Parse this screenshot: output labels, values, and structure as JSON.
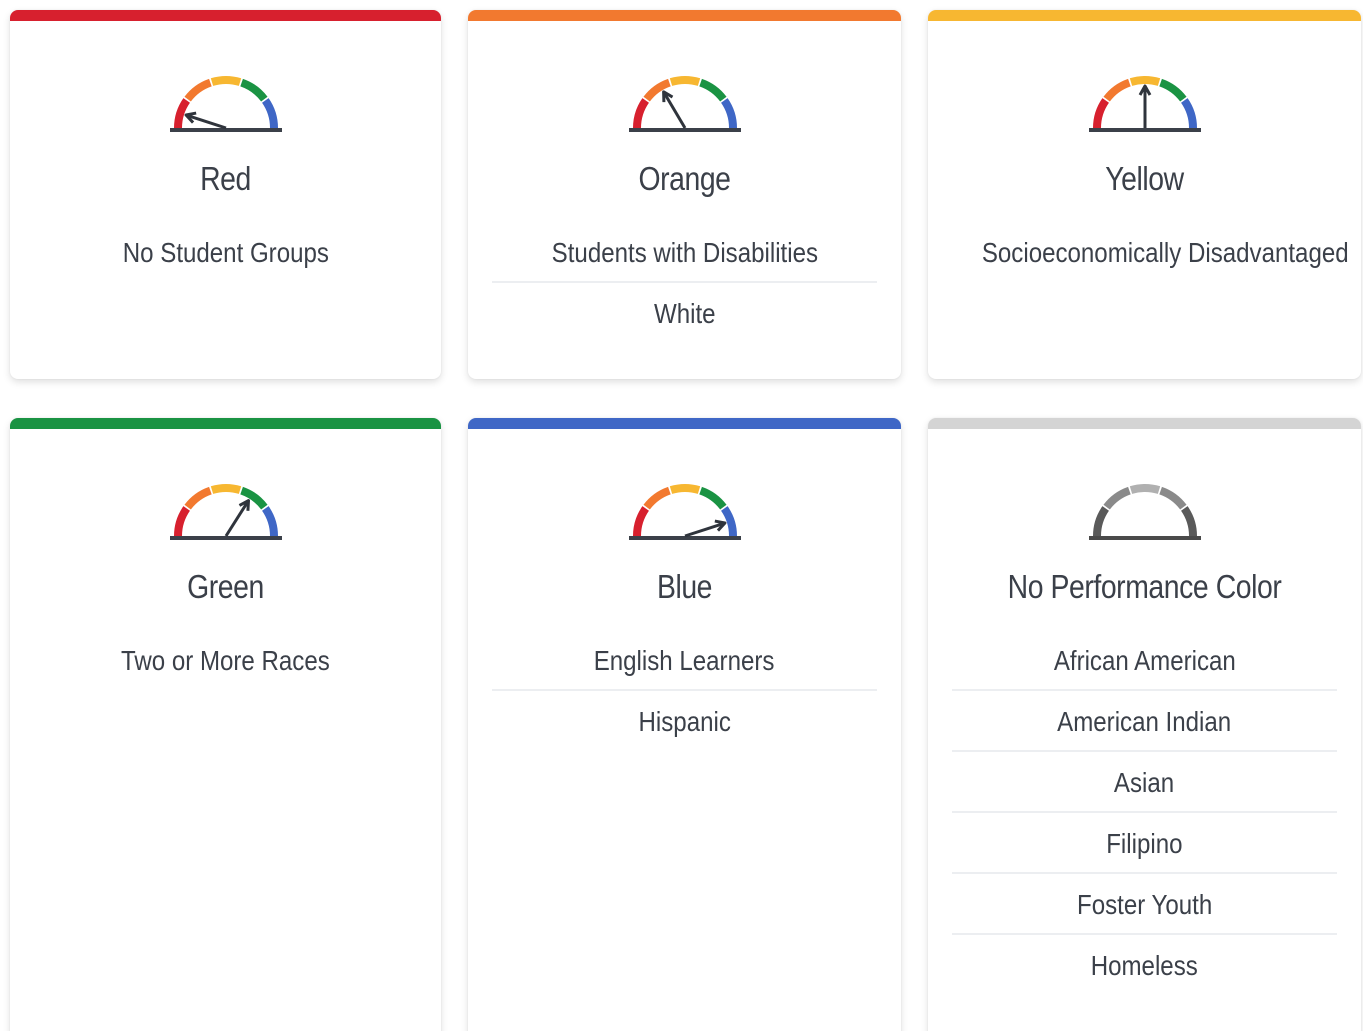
{
  "cards": [
    {
      "title": "Red",
      "accent": "#d7202e",
      "gauge": "active",
      "needle_level": 0.1,
      "groups": [
        "No Student Groups"
      ]
    },
    {
      "title": "Orange",
      "accent": "#f2792f",
      "gauge": "active",
      "needle_level": 0.33,
      "groups": [
        "Students with Disabilities",
        "White"
      ]
    },
    {
      "title": "Yellow",
      "accent": "#f7b731",
      "gauge": "active",
      "needle_level": 0.5,
      "groups": [
        "Socioeconomically Disadvantaged"
      ]
    },
    {
      "title": "Green",
      "accent": "#1a9343",
      "gauge": "active",
      "needle_level": 0.68,
      "groups": [
        "Two or More Races"
      ]
    },
    {
      "title": "Blue",
      "accent": "#3f67c6",
      "gauge": "active",
      "needle_level": 0.9,
      "groups": [
        "English Learners",
        "Hispanic"
      ]
    },
    {
      "title": "No Performance Color",
      "accent": "#d4d4d4",
      "gauge": "inactive",
      "needle_level": null,
      "groups": [
        "African American",
        "American Indian",
        "Asian",
        "Filipino",
        "Foster Youth",
        "Homeless"
      ]
    }
  ],
  "gauge_colors": {
    "segments": [
      "#d7202e",
      "#f2792f",
      "#f7b731",
      "#1a9343",
      "#3f67c6"
    ],
    "inactive_segments": [
      "#5a5a5a",
      "#8a8a8a",
      "#b0b0b0",
      "#8a8a8a",
      "#5a5a5a"
    ],
    "baseline": "#3b4049",
    "needle": "#2f343c"
  }
}
